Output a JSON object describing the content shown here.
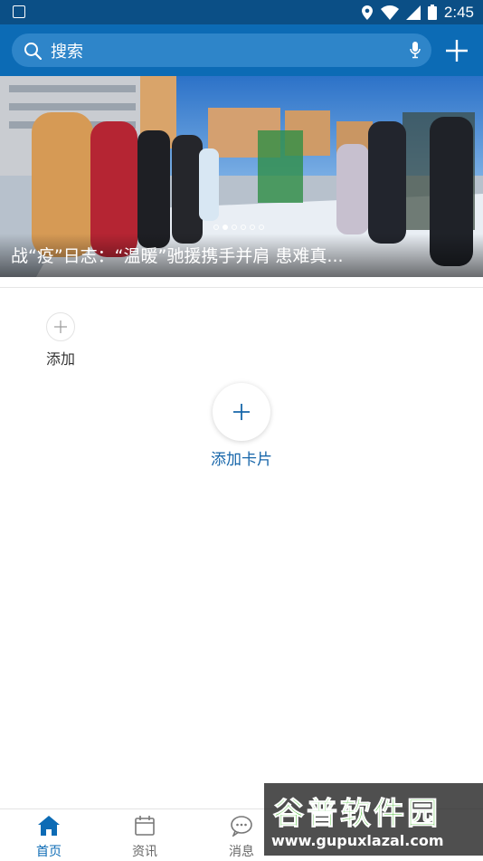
{
  "status_bar": {
    "time": "2:45"
  },
  "header": {
    "search_label": "搜索"
  },
  "banner": {
    "caption": "战“疫”日志：“温暖”驰援携手并肩  患难真...",
    "slide_count": 6,
    "active_slide": 1
  },
  "shortcuts": {
    "add_label": "添加"
  },
  "add_card": {
    "label": "添加卡片"
  },
  "bottom_nav": {
    "items": [
      {
        "label": "首页",
        "active": true
      },
      {
        "label": "资讯",
        "active": false
      },
      {
        "label": "消息",
        "active": false
      }
    ]
  },
  "watermark": {
    "name": "谷普软件园",
    "url": "www.gupuxlazal.com"
  },
  "colors": {
    "primary": "#0c6bb5",
    "status_bar": "#0b4f86",
    "accent_text": "#1766aa"
  }
}
